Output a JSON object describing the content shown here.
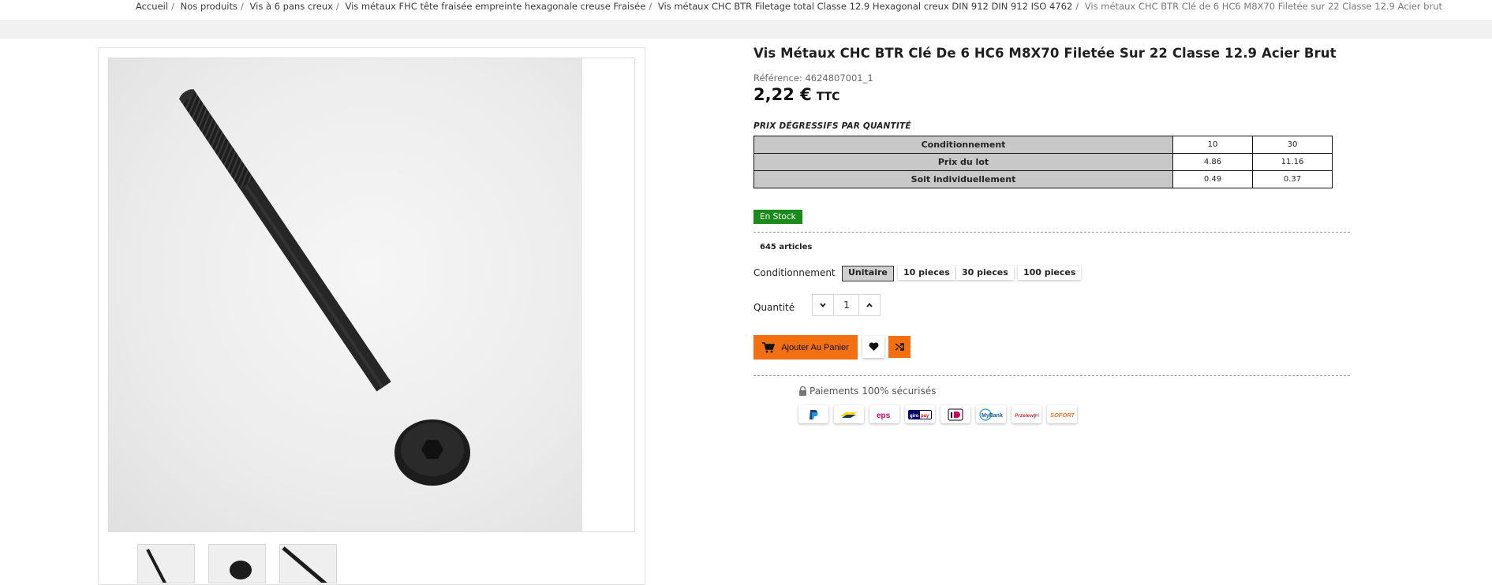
{
  "breadcrumb": [
    "Accueil",
    "Nos produits",
    "Vis à 6 pans creux",
    "Vis métaux FHC tête fraisée empreinte hexagonale creuse Fraisée",
    "Vis métaux CHC BTR Filetage total Classe 12.9 Hexagonal creux DIN 912 DIN 912 ISO 4762",
    "Vis métaux CHC BTR Clé de 6 HC6 M8X70 Filetée sur 22 Classe 12.9 Acier brut"
  ],
  "breadcrumb_separator": "/",
  "product": {
    "title": "Vis Métaux CHC BTR Clé De 6 HC6 M8X70 Filetée Sur 22 Classe 12.9 Acier Brut",
    "reference": "Référence: 4624807001_1",
    "price": "2,22 €",
    "tax_label": "TTC"
  },
  "qty_pricing": {
    "title": "PRIX DÉGRESSIFS PAR QUANTITÉ",
    "rows": [
      {
        "label": "Conditionnement",
        "values": [
          "10",
          "30"
        ]
      },
      {
        "label": "Prix du lot",
        "values": [
          "4.86",
          "11.16"
        ]
      },
      {
        "label": "Soit individuellement",
        "values": [
          "0.49",
          "0.37"
        ]
      }
    ]
  },
  "stock": {
    "badge": "En Stock",
    "count": "645 articles",
    "badge_color": "#1a8a1a"
  },
  "conditionnement": {
    "label": "Conditionnement",
    "options": [
      "Unitaire",
      "10 pieces",
      "30 pieces",
      "100 pieces"
    ],
    "selected": "Unitaire"
  },
  "quantity": {
    "label": "Quantité",
    "value": "1"
  },
  "actions": {
    "add_to_cart": "Ajouter Au Panier",
    "accent_color": "#f26f12"
  },
  "payment": {
    "secure_text": "Paiements 100% sécurisés",
    "methods": [
      "PayPal",
      "Bancontact",
      "EPS",
      "giropay",
      "iDEAL",
      "MyBank",
      "Przelewy24",
      "SOFORT"
    ]
  },
  "gallery": {
    "zoom_icon": "zoom-in-icon",
    "thumbnail_count": 3
  }
}
